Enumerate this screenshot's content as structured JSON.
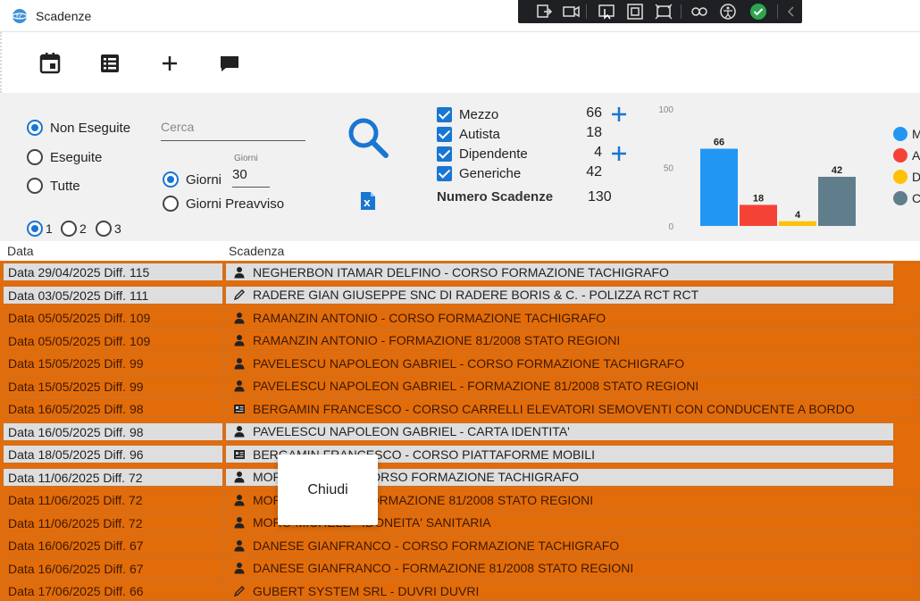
{
  "window": {
    "title": "Scadenze"
  },
  "toolbar": {
    "buttons": [
      {
        "name": "calendar-icon"
      },
      {
        "name": "list-icon"
      },
      {
        "name": "add-icon"
      },
      {
        "name": "chat-icon"
      }
    ]
  },
  "filters": {
    "status_options": [
      {
        "label": "Non Eseguite",
        "selected": true
      },
      {
        "label": "Eseguite",
        "selected": false
      },
      {
        "label": "Tutte",
        "selected": false
      }
    ],
    "search": {
      "placeholder": "Cerca",
      "value": ""
    },
    "giorni_label_small": "Giorni",
    "giorni_value": "30",
    "mode_options": [
      {
        "label": "Giorni",
        "selected": true
      },
      {
        "label": "Giorni Preavviso",
        "selected": false
      }
    ],
    "level_options": [
      {
        "label": "1",
        "selected": true
      },
      {
        "label": "2",
        "selected": false
      },
      {
        "label": "3",
        "selected": false
      }
    ]
  },
  "categories": [
    {
      "label": "Mezzo",
      "count": "66",
      "checked": true,
      "add": true
    },
    {
      "label": "Autista",
      "count": "18",
      "checked": true,
      "add": false
    },
    {
      "label": "Dipendente",
      "count": "4",
      "checked": true,
      "add": true
    },
    {
      "label": "Generiche",
      "count": "42",
      "checked": true,
      "add": false
    }
  ],
  "total": {
    "label": "Numero Scadenze",
    "value": "130"
  },
  "chart_data": {
    "type": "bar",
    "categories": [
      "Mezzo",
      "Autista",
      "Dipendente",
      "Generiche"
    ],
    "values": [
      66,
      18,
      4,
      42
    ],
    "colors": [
      "#2196f3",
      "#f44336",
      "#ffc107",
      "#607d8b"
    ],
    "ylim": [
      0,
      100
    ],
    "yticks": [
      "100",
      "50",
      "0"
    ],
    "legend": [
      "M",
      "A",
      "D",
      "C"
    ],
    "legend_position": "right"
  },
  "table": {
    "headers": {
      "date": "Data",
      "scadenza": "Scadenza"
    },
    "rows": [
      {
        "date": "Data 29/04/2025 Diff. 115",
        "icon": "person-icon",
        "text": "NEGHERBON ITAMAR DELFINO - CORSO FORMAZIONE TACHIGRAFO",
        "style": "gray"
      },
      {
        "date": "Data 03/05/2025 Diff. 111",
        "icon": "pencil-icon",
        "text": "RADERE GIAN GIUSEPPE SNC DI RADERE BORIS & C. - POLIZZA RCT RCT",
        "style": "gray"
      },
      {
        "date": "Data 05/05/2025 Diff. 109",
        "icon": "person-icon",
        "text": "RAMANZIN ANTONIO - CORSO FORMAZIONE TACHIGRAFO",
        "style": "orange"
      },
      {
        "date": "Data 05/05/2025 Diff. 109",
        "icon": "person-icon",
        "text": "RAMANZIN ANTONIO - FORMAZIONE 81/2008 STATO REGIONI",
        "style": "orange"
      },
      {
        "date": "Data 15/05/2025 Diff. 99",
        "icon": "person-icon",
        "text": "PAVELESCU NAPOLEON GABRIEL - CORSO FORMAZIONE TACHIGRAFO",
        "style": "orange"
      },
      {
        "date": "Data 15/05/2025 Diff. 99",
        "icon": "person-icon",
        "text": "PAVELESCU NAPOLEON GABRIEL - FORMAZIONE 81/2008 STATO REGIONI",
        "style": "orange"
      },
      {
        "date": "Data 16/05/2025 Diff. 98",
        "icon": "id-card-icon",
        "text": "BERGAMIN FRANCESCO - CORSO CARRELLI ELEVATORI SEMOVENTI CON CONDUCENTE A BORDO",
        "style": "orange"
      },
      {
        "date": "Data 16/05/2025 Diff. 98",
        "icon": "person-icon",
        "text": "PAVELESCU NAPOLEON GABRIEL - CARTA IDENTITA'",
        "style": "gray"
      },
      {
        "date": "Data 18/05/2025 Diff. 96",
        "icon": "id-card-icon",
        "text": "BERGAMIN FRANCESCO - CORSO PIATTAFORME MOBILI",
        "style": "gray"
      },
      {
        "date": "Data 11/06/2025 Diff. 72",
        "icon": "person-icon",
        "text": "MORO MICHELE - CORSO FORMAZIONE TACHIGRAFO",
        "style": "gray"
      },
      {
        "date": "Data 11/06/2025 Diff. 72",
        "icon": "person-icon",
        "text": "MORO MICHELE - FORMAZIONE 81/2008 STATO REGIONI",
        "style": "orange"
      },
      {
        "date": "Data 11/06/2025 Diff. 72",
        "icon": "person-icon",
        "text": "MORO MICHELE - IDONEITA' SANITARIA",
        "style": "orange"
      },
      {
        "date": "Data 16/06/2025 Diff. 67",
        "icon": "person-icon",
        "text": "DANESE GIANFRANCO - CORSO FORMAZIONE TACHIGRAFO",
        "style": "orange"
      },
      {
        "date": "Data 16/06/2025 Diff. 67",
        "icon": "person-icon",
        "text": "DANESE GIANFRANCO - FORMAZIONE 81/2008 STATO REGIONI",
        "style": "orange"
      },
      {
        "date": "Data 17/06/2025 Diff. 66",
        "icon": "pencil-icon",
        "text": "GUBERT SYSTEM SRL - DUVRI DUVRI",
        "style": "orange"
      }
    ]
  },
  "popup": {
    "label": "Chiudi"
  }
}
